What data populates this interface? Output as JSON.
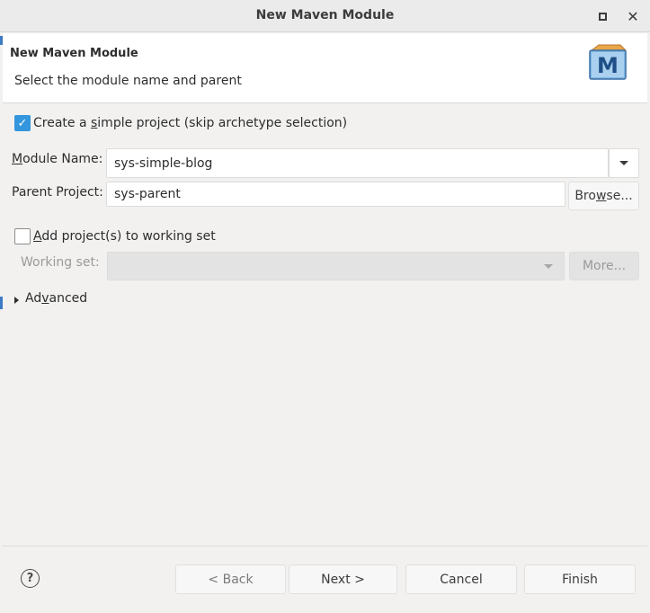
{
  "window": {
    "title": "New Maven Module"
  },
  "header": {
    "title": "New Maven Module",
    "subtitle": "Select the module name and parent",
    "logo_letter": "M"
  },
  "simple_project": {
    "checked": true,
    "label_pre": "Create a ",
    "label_u": "s",
    "label_post": "imple project (skip archetype selection)"
  },
  "module_name": {
    "label_u": "M",
    "label_post": "odule Name:",
    "value": "sys-simple-blog"
  },
  "parent_project": {
    "label": "Parent Project:",
    "value": "sys-parent",
    "browse_pre": "Bro",
    "browse_u": "w",
    "browse_post": "se..."
  },
  "working_set": {
    "checked": false,
    "add_u": "A",
    "add_post": "dd project(s) to working set",
    "label": "Working set:",
    "value": "",
    "more_label": "More..."
  },
  "advanced": {
    "pre": "Ad",
    "u": "v",
    "post": "anced"
  },
  "footer": {
    "help_glyph": "?",
    "back_label": "< Back",
    "next_label": "Next >",
    "cancel_label": "Cancel",
    "finish_label": "Finish"
  },
  "colors": {
    "accent": "#3496dc",
    "dialog_bg": "#f2f1f0"
  }
}
